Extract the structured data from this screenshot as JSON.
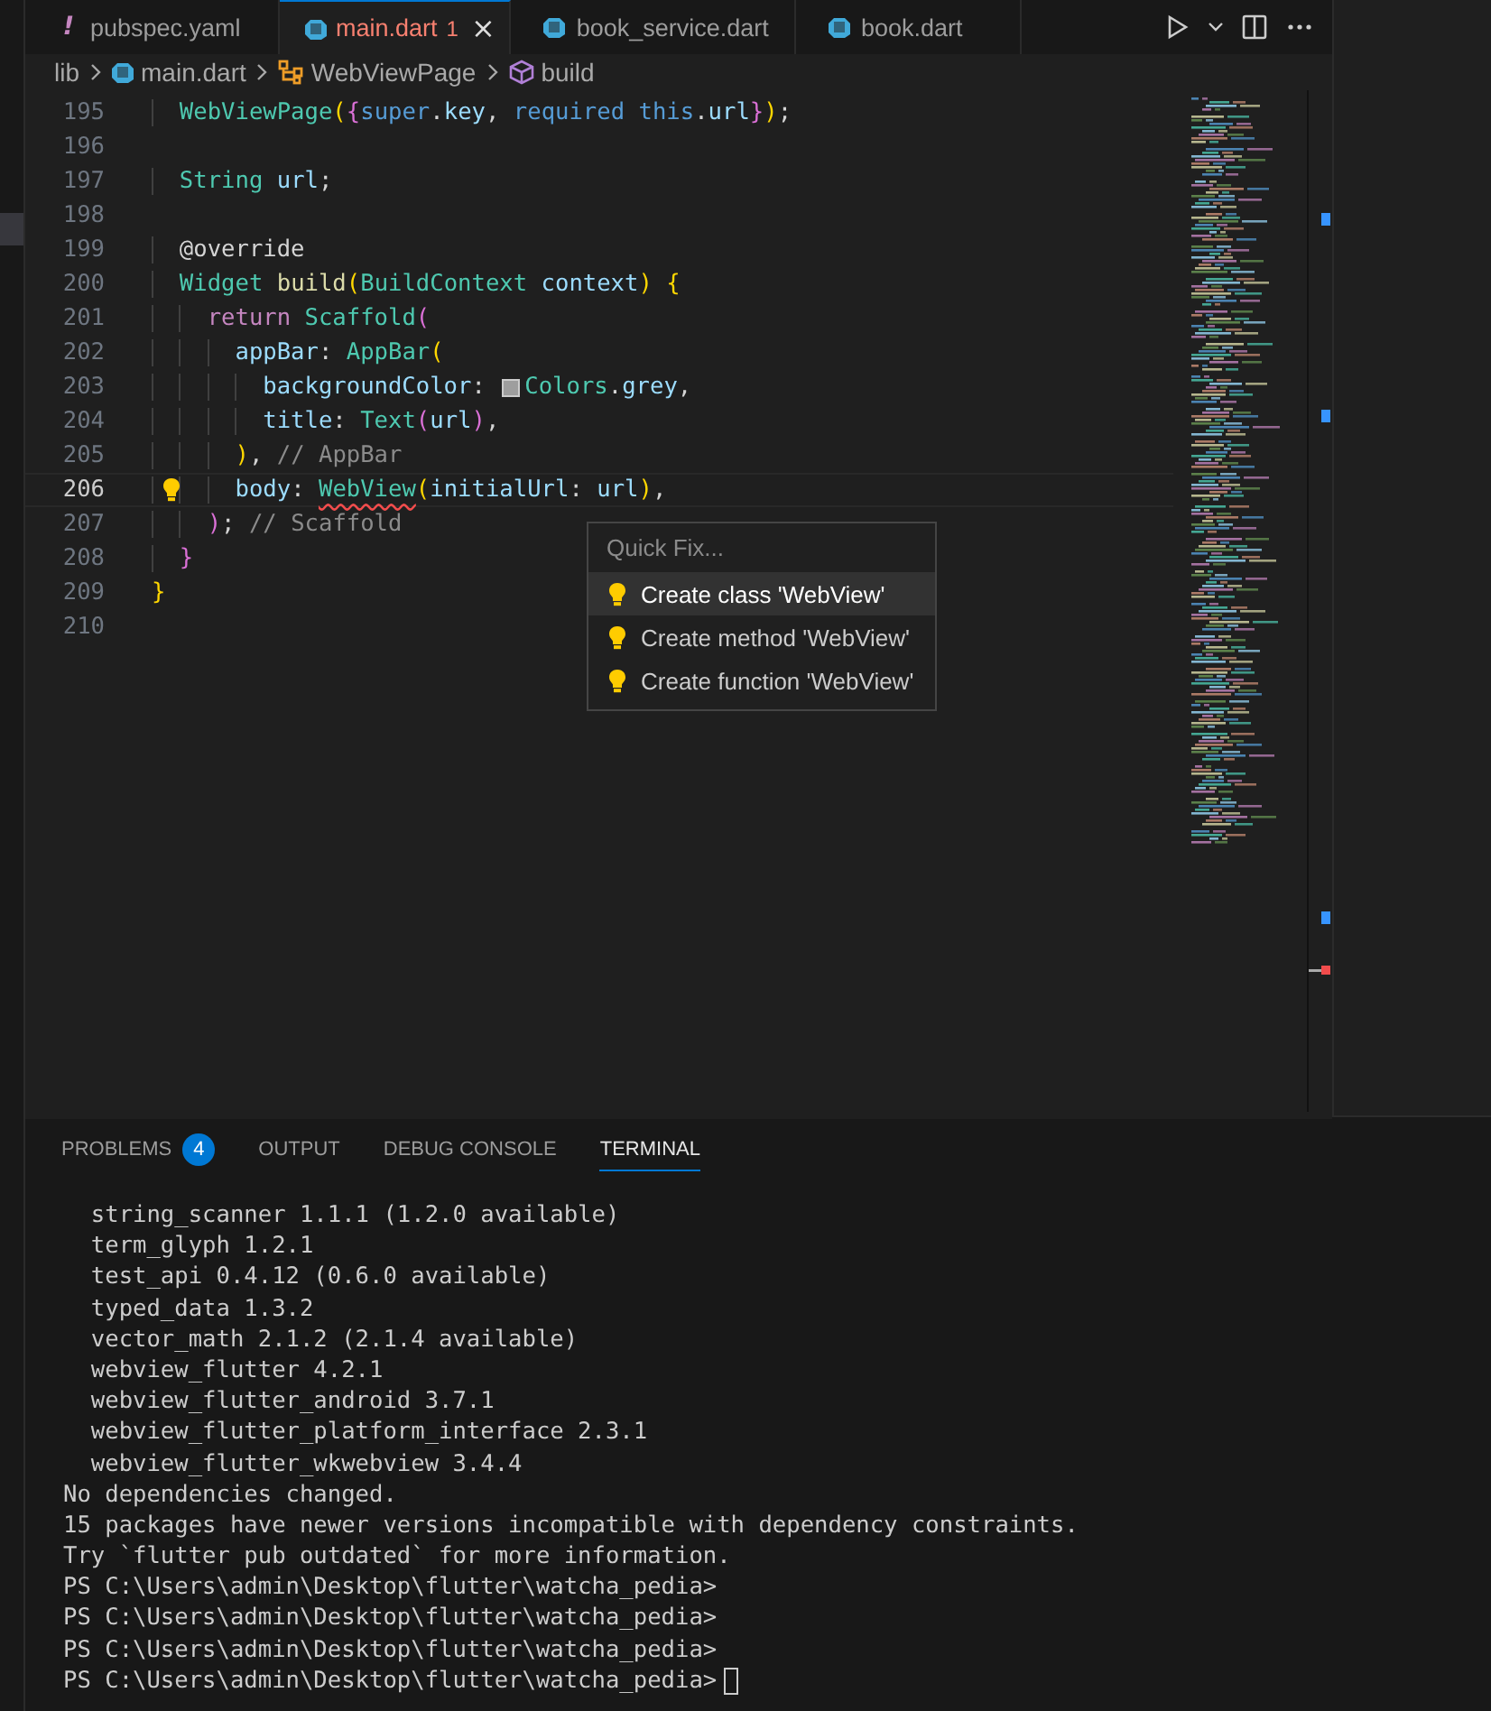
{
  "tabs": [
    {
      "kind": "config",
      "glyph": "!",
      "label": "pubspec.yaml",
      "selected": false,
      "error": false
    },
    {
      "kind": "source",
      "label": "main.dart",
      "selected": true,
      "error": true,
      "badge": "1",
      "close": "×"
    },
    {
      "kind": "source",
      "label": "book_service.dart",
      "selected": false,
      "error": false
    },
    {
      "kind": "source",
      "label": "book.dart",
      "selected": false,
      "error": false
    }
  ],
  "breadcrumb": [
    {
      "kind": "folder",
      "label": "lib"
    },
    {
      "kind": "file",
      "label": "main.dart"
    },
    {
      "kind": "class",
      "label": "WebViewPage"
    },
    {
      "kind": "method",
      "label": "build"
    }
  ],
  "code_lines": [
    {
      "number": "195",
      "current": false,
      "lightbulb": false,
      "tokens": [
        {
          "text": "  WebViewPage",
          "kind": "type"
        },
        {
          "text": "(",
          "kind": "b1"
        },
        {
          "text": "{",
          "kind": "b2"
        },
        {
          "text": "super",
          "kind": "kw"
        },
        {
          "text": ".",
          "kind": "plain"
        },
        {
          "text": "key",
          "kind": "var"
        },
        {
          "text": ", ",
          "kind": "plain"
        },
        {
          "text": "required ",
          "kind": "kw"
        },
        {
          "text": "this",
          "kind": "kw"
        },
        {
          "text": ".",
          "kind": "plain"
        },
        {
          "text": "url",
          "kind": "var"
        },
        {
          "text": "}",
          "kind": "b2"
        },
        {
          "text": ")",
          "kind": "b1"
        },
        {
          "text": ";",
          "kind": "plain"
        }
      ]
    },
    {
      "number": "196",
      "current": false,
      "lightbulb": false
    },
    {
      "number": "197",
      "current": false,
      "lightbulb": false,
      "tokens": [
        {
          "text": "  String ",
          "kind": "type"
        },
        {
          "text": "url",
          "kind": "var"
        },
        {
          "text": ";",
          "kind": "plain"
        }
      ]
    },
    {
      "number": "198",
      "current": false,
      "lightbulb": false
    },
    {
      "number": "199",
      "current": false,
      "lightbulb": false,
      "tokens": [
        {
          "text": "  @override",
          "kind": "plain"
        }
      ]
    },
    {
      "number": "200",
      "current": false,
      "lightbulb": false,
      "tokens": [
        {
          "text": "  Widget ",
          "kind": "type"
        },
        {
          "text": "build",
          "kind": "fn"
        },
        {
          "text": "(",
          "kind": "b1"
        },
        {
          "text": "BuildContext ",
          "kind": "type"
        },
        {
          "text": "context",
          "kind": "var"
        },
        {
          "text": ") ",
          "kind": "b1"
        },
        {
          "text": "{",
          "kind": "b1"
        }
      ]
    },
    {
      "number": "201",
      "current": false,
      "lightbulb": false,
      "tokens": [
        {
          "text": "    return ",
          "kind": "ctrl"
        },
        {
          "text": "Scaffold",
          "kind": "type"
        },
        {
          "text": "(",
          "kind": "b2"
        }
      ]
    },
    {
      "number": "202",
      "current": false,
      "lightbulb": false,
      "tokens": [
        {
          "text": "      appBar",
          "kind": "var"
        },
        {
          "text": ": ",
          "kind": "plain"
        },
        {
          "text": "AppBar",
          "kind": "type"
        },
        {
          "text": "(",
          "kind": "b1"
        }
      ]
    },
    {
      "number": "203",
      "current": false,
      "lightbulb": false,
      "tokens": [
        {
          "text": "        backgroundColor",
          "kind": "var"
        },
        {
          "text": ": ",
          "kind": "plain"
        },
        {
          "kind": "swatch",
          "color": "#9e9e9e"
        },
        {
          "text": "Colors",
          "kind": "type"
        },
        {
          "text": ".",
          "kind": "plain"
        },
        {
          "text": "grey",
          "kind": "var"
        },
        {
          "text": ",",
          "kind": "plain"
        }
      ]
    },
    {
      "number": "204",
      "current": false,
      "lightbulb": false,
      "tokens": [
        {
          "text": "        title",
          "kind": "var"
        },
        {
          "text": ": ",
          "kind": "plain"
        },
        {
          "text": "Text",
          "kind": "type"
        },
        {
          "text": "(",
          "kind": "b2"
        },
        {
          "text": "url",
          "kind": "var"
        },
        {
          "text": ")",
          "kind": "b2"
        },
        {
          "text": ",",
          "kind": "plain"
        }
      ]
    },
    {
      "number": "205",
      "current": false,
      "lightbulb": false,
      "tokens": [
        {
          "text": "      )",
          "kind": "b1"
        },
        {
          "text": ", ",
          "kind": "plain"
        },
        {
          "text": "// AppBar",
          "kind": "comment"
        }
      ]
    },
    {
      "number": "206",
      "current": true,
      "lightbulb": true,
      "tokens": [
        {
          "text": "      body",
          "kind": "var"
        },
        {
          "text": ": ",
          "kind": "plain"
        },
        {
          "text": "WebView",
          "kind": "error"
        },
        {
          "text": "(",
          "kind": "b1"
        },
        {
          "text": "initialUrl",
          "kind": "var"
        },
        {
          "text": ": ",
          "kind": "plain"
        },
        {
          "text": "url",
          "kind": "var"
        },
        {
          "text": ")",
          "kind": "b1"
        },
        {
          "text": ",",
          "kind": "plain"
        }
      ]
    },
    {
      "number": "207",
      "current": false,
      "lightbulb": false,
      "tokens": [
        {
          "text": "    )",
          "kind": "b2"
        },
        {
          "text": "; ",
          "kind": "plain"
        },
        {
          "text": "// Scaffold",
          "kind": "comment"
        }
      ]
    },
    {
      "number": "208",
      "current": false,
      "lightbulb": false,
      "tokens": [
        {
          "text": "  }",
          "kind": "b2"
        }
      ]
    },
    {
      "number": "209",
      "current": false,
      "lightbulb": false,
      "tokens": [
        {
          "text": "}",
          "kind": "b1"
        }
      ]
    },
    {
      "number": "210",
      "current": false,
      "lightbulb": false
    }
  ],
  "quick_fix": {
    "title": "Quick Fix...",
    "items": [
      {
        "label": "Create class 'WebView'",
        "selected": true
      },
      {
        "label": "Create method 'WebView'",
        "selected": false
      },
      {
        "label": "Create function 'WebView'",
        "selected": false
      }
    ]
  },
  "panel_tabs": [
    {
      "label": "PROBLEMS",
      "badge": "4",
      "selected": false
    },
    {
      "label": "OUTPUT",
      "selected": false
    },
    {
      "label": "DEBUG CONSOLE",
      "selected": false
    },
    {
      "label": "TERMINAL",
      "selected": true
    }
  ],
  "terminal_lines": [
    "  string_scanner 1.1.1 (1.2.0 available)",
    "  term_glyph 1.2.1",
    "  test_api 0.4.12 (0.6.0 available)",
    "  typed_data 1.3.2",
    "  vector_math 2.1.2 (2.1.4 available)",
    "  webview_flutter 4.2.1",
    "  webview_flutter_android 3.7.1",
    "  webview_flutter_platform_interface 2.3.1",
    "  webview_flutter_wkwebview 3.4.4",
    "No dependencies changed.",
    "15 packages have newer versions incompatible with dependency constraints.",
    "Try `flutter pub outdated` for more information.",
    "PS C:\\Users\\admin\\Desktop\\flutter\\watcha_pedia>",
    "PS C:\\Users\\admin\\Desktop\\flutter\\watcha_pedia>",
    "PS C:\\Users\\admin\\Desktop\\flutter\\watcha_pedia>",
    "PS C:\\Users\\admin\\Desktop\\flutter\\watcha_pedia>"
  ]
}
